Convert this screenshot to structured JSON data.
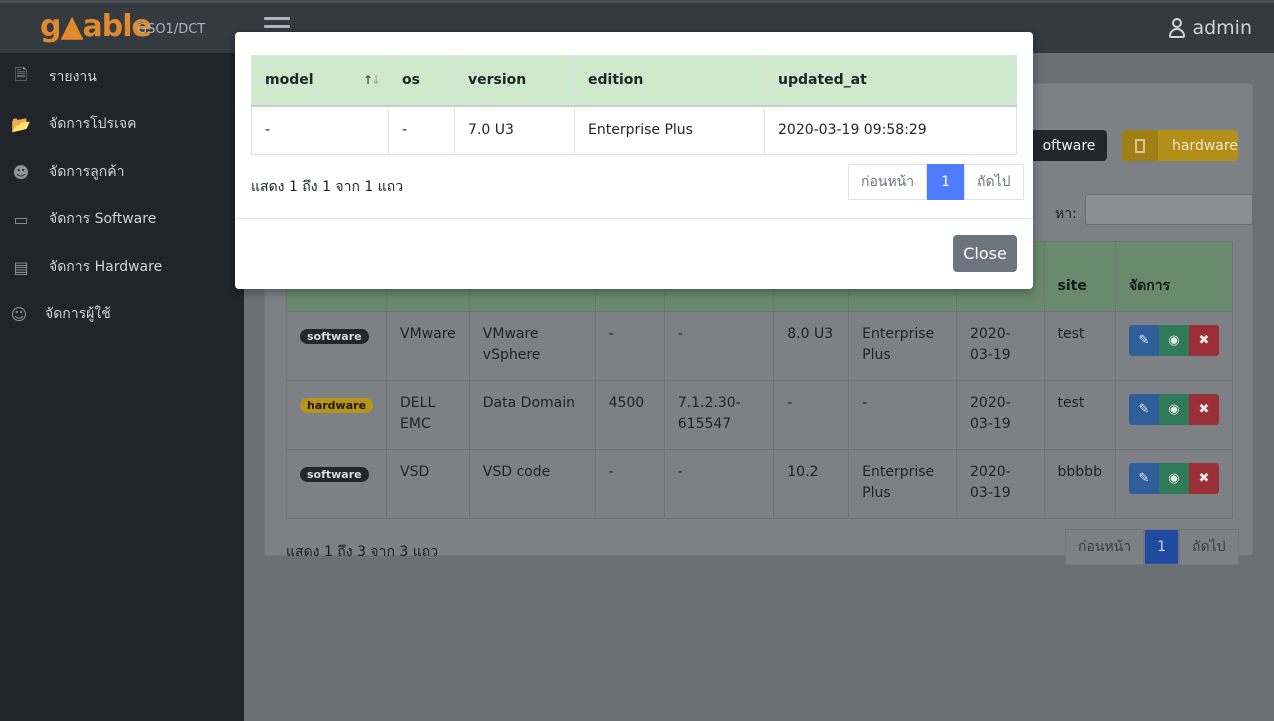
{
  "header": {
    "logo": "g▲able",
    "logo_sub": "GSO1/DCT",
    "user": "admin"
  },
  "sidebar": {
    "items": [
      {
        "label": "รายงาน",
        "icon": "excel-file-icon"
      },
      {
        "label": "จัดการโปรเจค",
        "icon": "folder-open-icon"
      },
      {
        "label": "จัดการลูกค้า",
        "icon": "users-icon"
      },
      {
        "label": "จัดการ Software",
        "icon": "laptop-icon"
      },
      {
        "label": "จัดการ Hardware",
        "icon": "microchip-icon"
      },
      {
        "label": "จัดการผู้ใช้",
        "icon": "user-plus-icon"
      }
    ]
  },
  "main": {
    "software_button": "oftware",
    "hardware_button": "hardware",
    "search_label": "หา:",
    "table": {
      "headers": [
        "",
        "",
        "",
        "",
        "",
        "",
        "",
        "",
        "site",
        "จัดการ"
      ],
      "rows": [
        {
          "type": "software",
          "vendor": "VMware",
          "product": "VMware vSphere",
          "model": "-",
          "os": "-",
          "version": "8.0 U3",
          "edition": "Enterprise Plus",
          "date": "2020-03-19",
          "site": "test"
        },
        {
          "type": "hardware",
          "vendor": "DELL EMC",
          "product": "Data Domain",
          "model": "4500",
          "os": "7.1.2.30-615547",
          "version": "-",
          "edition": "-",
          "date": "2020-03-19",
          "site": "test"
        },
        {
          "type": "software",
          "vendor": "VSD",
          "product": "VSD code",
          "model": "-",
          "os": "-",
          "version": "10.2",
          "edition": "Enterprise Plus",
          "date": "2020-03-19",
          "site": "bbbbb"
        }
      ]
    },
    "info": "แสดง 1 ถึง 3 จาก 3 แถว",
    "pager": {
      "prev": "ก่อนหน้า",
      "current": "1",
      "next": "ถัดไป"
    }
  },
  "modal": {
    "table": {
      "headers": [
        "model",
        "os",
        "version",
        "edition",
        "updated_at"
      ],
      "rows": [
        {
          "model": "-",
          "os": "-",
          "version": "7.0 U3",
          "edition": "Enterprise Plus",
          "updated_at": "2020-03-19 09:58:29"
        }
      ]
    },
    "info": "แสดง 1 ถึง 1 จาก 1 แถว",
    "pager": {
      "prev": "ก่อนหน้า",
      "current": "1",
      "next": "ถัดไป"
    },
    "close_label": "Close"
  }
}
